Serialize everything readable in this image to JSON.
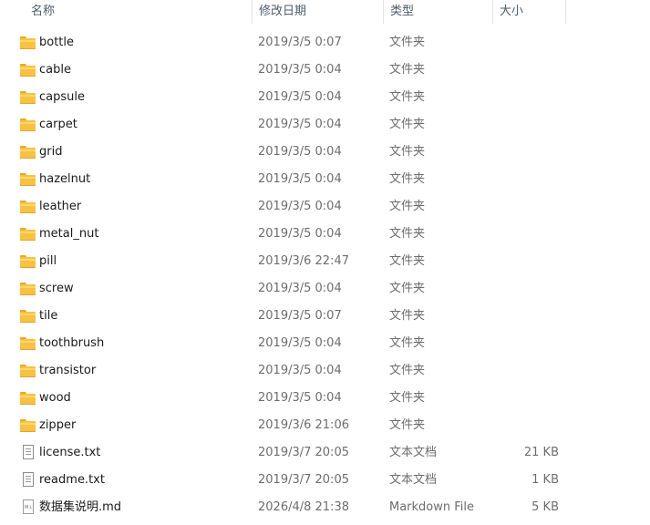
{
  "columns": {
    "name": "名称",
    "date": "修改日期",
    "type": "类型",
    "size": "大小"
  },
  "icons": {
    "folder": "folder-icon",
    "text": "text-file-icon",
    "markdown": "markdown-file-icon"
  },
  "files": [
    {
      "name": "bottle",
      "date": "2019/3/5 0:07",
      "type": "文件夹",
      "size": "",
      "kind": "folder"
    },
    {
      "name": "cable",
      "date": "2019/3/5 0:04",
      "type": "文件夹",
      "size": "",
      "kind": "folder"
    },
    {
      "name": "capsule",
      "date": "2019/3/5 0:04",
      "type": "文件夹",
      "size": "",
      "kind": "folder"
    },
    {
      "name": "carpet",
      "date": "2019/3/5 0:04",
      "type": "文件夹",
      "size": "",
      "kind": "folder"
    },
    {
      "name": "grid",
      "date": "2019/3/5 0:04",
      "type": "文件夹",
      "size": "",
      "kind": "folder"
    },
    {
      "name": "hazelnut",
      "date": "2019/3/5 0:04",
      "type": "文件夹",
      "size": "",
      "kind": "folder"
    },
    {
      "name": "leather",
      "date": "2019/3/5 0:04",
      "type": "文件夹",
      "size": "",
      "kind": "folder"
    },
    {
      "name": "metal_nut",
      "date": "2019/3/5 0:04",
      "type": "文件夹",
      "size": "",
      "kind": "folder"
    },
    {
      "name": "pill",
      "date": "2019/3/6 22:47",
      "type": "文件夹",
      "size": "",
      "kind": "folder"
    },
    {
      "name": "screw",
      "date": "2019/3/5 0:04",
      "type": "文件夹",
      "size": "",
      "kind": "folder"
    },
    {
      "name": "tile",
      "date": "2019/3/5 0:07",
      "type": "文件夹",
      "size": "",
      "kind": "folder"
    },
    {
      "name": "toothbrush",
      "date": "2019/3/5 0:04",
      "type": "文件夹",
      "size": "",
      "kind": "folder"
    },
    {
      "name": "transistor",
      "date": "2019/3/5 0:04",
      "type": "文件夹",
      "size": "",
      "kind": "folder"
    },
    {
      "name": "wood",
      "date": "2019/3/5 0:04",
      "type": "文件夹",
      "size": "",
      "kind": "folder"
    },
    {
      "name": "zipper",
      "date": "2019/3/6 21:06",
      "type": "文件夹",
      "size": "",
      "kind": "folder"
    },
    {
      "name": "license.txt",
      "date": "2019/3/7 20:05",
      "type": "文本文档",
      "size": "21 KB",
      "kind": "text"
    },
    {
      "name": "readme.txt",
      "date": "2019/3/7 20:05",
      "type": "文本文档",
      "size": "1 KB",
      "kind": "text"
    },
    {
      "name": "数据集说明.md",
      "date": "2026/4/8 21:38",
      "type": "Markdown File",
      "size": "5 KB",
      "kind": "markdown"
    }
  ]
}
